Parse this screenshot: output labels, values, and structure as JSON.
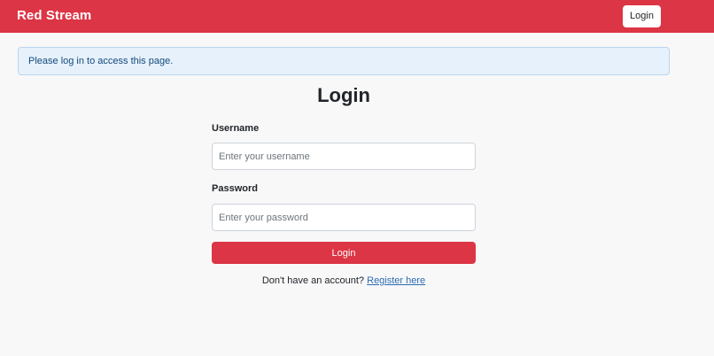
{
  "navbar": {
    "brand": "Red Stream",
    "login_label": "Login"
  },
  "alert": {
    "message": "Please log in to access this page."
  },
  "form": {
    "title": "Login",
    "username_label": "Username",
    "username_placeholder": "Enter your username",
    "username_value": "",
    "password_label": "Password",
    "password_placeholder": "Enter your password",
    "password_value": "",
    "submit_label": "Login"
  },
  "footer": {
    "prompt": "Don't have an account?",
    "register_link": "Register here"
  },
  "colors": {
    "brand": "#dc3545",
    "alert_bg": "#e7f1fb",
    "link": "#2b6cb0"
  }
}
